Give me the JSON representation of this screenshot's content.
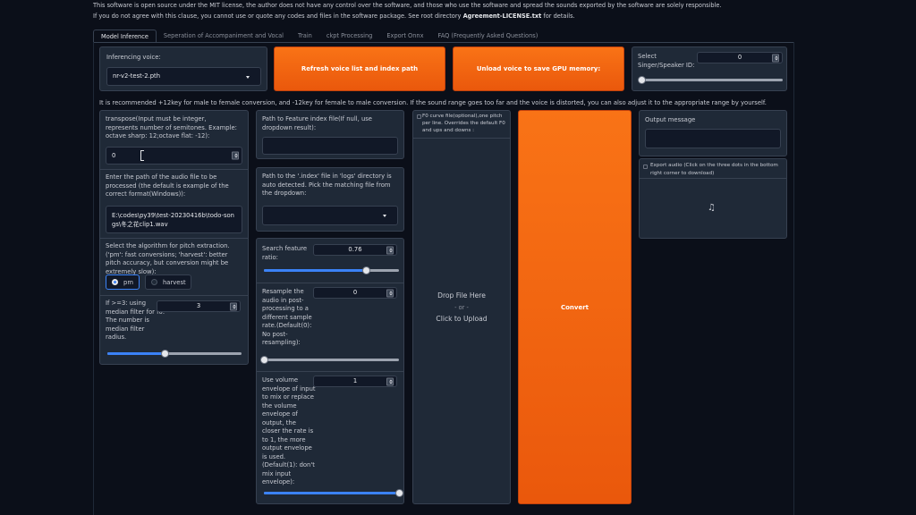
{
  "notice": {
    "line1": "This software is open source under the MIT license, the author does not have any control over the software, and those who use the software and spread the sounds exported by the software are solely responsible.",
    "line2_prefix": "If you do not agree with this clause, you cannot use or quote any codes and files in the software package. See root directory ",
    "line2_bold": "Agreement-LICENSE.txt",
    "line2_suffix": " for details."
  },
  "tabs": [
    "Model Inference",
    "Seperation of Accompaniment and Vocal",
    "Train",
    "ckpt Processing",
    "Export Onnx",
    "FAQ (Frequently Asked Questions)"
  ],
  "inferencing": {
    "label": "Inferencing voice:",
    "selected": "nr-v2-test-2.pth"
  },
  "buttons": {
    "refresh": "Refresh voice list and index path",
    "unload": "Unload voice to save GPU memory:",
    "convert": "Convert"
  },
  "speaker": {
    "label": "Select Singer/Speaker ID:",
    "value": "0",
    "slider_fraction": 0
  },
  "recommend_text": "It is recommended +12key for male to female conversion, and -12key for female to male conversion. If the sound range goes too far and the voice is distorted, you can also adjust it to the appropriate range by yourself.",
  "transpose": {
    "label": "transpose(Input must be integer, represents number of semitones. Example: octave sharp: 12;octave flat: -12):",
    "value": "0"
  },
  "audio_path": {
    "label": "Enter the path of the audio file to be processed (the default is example of the correct format(Windows)):",
    "value": "E:\\codes\\py39\\test-20230416b\\todo-songs\\冬之花clip1.wav"
  },
  "pitch_algo": {
    "label": "Select the algorithm for pitch extraction.('pm': fast conversions; 'harvest': better pitch accuracy, but conversion might be extremely slow):",
    "options": [
      "pm",
      "harvest"
    ],
    "selected": "pm"
  },
  "median_filter": {
    "label": "If >=3: using median filter for f0. The number is median filter radius.",
    "value": "3",
    "slider_fraction": 0.43
  },
  "feature_path": {
    "label": "Path to Feature index file(If null, use dropdown result):",
    "value": ""
  },
  "index_path": {
    "label": "Path to the '.index' file in 'logs' directory is auto detected. Pick the matching file from the dropdown:",
    "value": ""
  },
  "feature_ratio": {
    "label": "Search feature ratio:",
    "value": "0.76",
    "slider_fraction": 0.76
  },
  "resample": {
    "label": "Resample the audio in post-processing to a different sample rate.(Default(0): No post-resampling):",
    "value": "0",
    "slider_fraction": 0
  },
  "volume_envelope": {
    "label": "Use volume envelope of input to mix or replace the volume envelope of output, the closer the rate is to 1, the more output envelope is used.(Default(1): don't mix input envelope):",
    "value": "1",
    "slider_fraction": 1
  },
  "f0_file": {
    "label": "F0 curve file(optional),one pitch per line. Overrides the default F0 and ups and downs :",
    "drop": "Drop File Here",
    "or": "- or -",
    "click": "Click to Upload"
  },
  "output": {
    "label": "Output message",
    "value": ""
  },
  "export_audio": {
    "label": "Export audio (Click on the three dots in the bottom right corner to download)"
  },
  "icons": {
    "music": "music-note-icon",
    "cursor": "text-cursor-icon"
  },
  "colors": {
    "background": "#0b0f19",
    "panel": "#1f2937",
    "accent_orange": "#f97316",
    "slider_blue": "#3b82f6"
  }
}
